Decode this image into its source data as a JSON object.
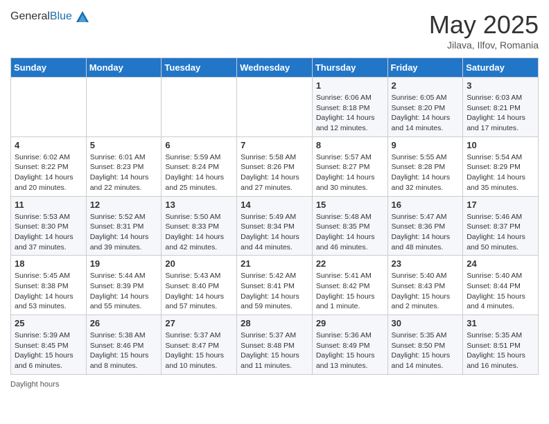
{
  "header": {
    "logo_general": "General",
    "logo_blue": "Blue",
    "month_title": "May 2025",
    "location": "Jilava, Ilfov, Romania"
  },
  "days_of_week": [
    "Sunday",
    "Monday",
    "Tuesday",
    "Wednesday",
    "Thursday",
    "Friday",
    "Saturday"
  ],
  "weeks": [
    [
      {
        "day": "",
        "info": ""
      },
      {
        "day": "",
        "info": ""
      },
      {
        "day": "",
        "info": ""
      },
      {
        "day": "",
        "info": ""
      },
      {
        "day": "1",
        "info": "Sunrise: 6:06 AM\nSunset: 8:18 PM\nDaylight: 14 hours\nand 12 minutes."
      },
      {
        "day": "2",
        "info": "Sunrise: 6:05 AM\nSunset: 8:20 PM\nDaylight: 14 hours\nand 14 minutes."
      },
      {
        "day": "3",
        "info": "Sunrise: 6:03 AM\nSunset: 8:21 PM\nDaylight: 14 hours\nand 17 minutes."
      }
    ],
    [
      {
        "day": "4",
        "info": "Sunrise: 6:02 AM\nSunset: 8:22 PM\nDaylight: 14 hours\nand 20 minutes."
      },
      {
        "day": "5",
        "info": "Sunrise: 6:01 AM\nSunset: 8:23 PM\nDaylight: 14 hours\nand 22 minutes."
      },
      {
        "day": "6",
        "info": "Sunrise: 5:59 AM\nSunset: 8:24 PM\nDaylight: 14 hours\nand 25 minutes."
      },
      {
        "day": "7",
        "info": "Sunrise: 5:58 AM\nSunset: 8:26 PM\nDaylight: 14 hours\nand 27 minutes."
      },
      {
        "day": "8",
        "info": "Sunrise: 5:57 AM\nSunset: 8:27 PM\nDaylight: 14 hours\nand 30 minutes."
      },
      {
        "day": "9",
        "info": "Sunrise: 5:55 AM\nSunset: 8:28 PM\nDaylight: 14 hours\nand 32 minutes."
      },
      {
        "day": "10",
        "info": "Sunrise: 5:54 AM\nSunset: 8:29 PM\nDaylight: 14 hours\nand 35 minutes."
      }
    ],
    [
      {
        "day": "11",
        "info": "Sunrise: 5:53 AM\nSunset: 8:30 PM\nDaylight: 14 hours\nand 37 minutes."
      },
      {
        "day": "12",
        "info": "Sunrise: 5:52 AM\nSunset: 8:31 PM\nDaylight: 14 hours\nand 39 minutes."
      },
      {
        "day": "13",
        "info": "Sunrise: 5:50 AM\nSunset: 8:33 PM\nDaylight: 14 hours\nand 42 minutes."
      },
      {
        "day": "14",
        "info": "Sunrise: 5:49 AM\nSunset: 8:34 PM\nDaylight: 14 hours\nand 44 minutes."
      },
      {
        "day": "15",
        "info": "Sunrise: 5:48 AM\nSunset: 8:35 PM\nDaylight: 14 hours\nand 46 minutes."
      },
      {
        "day": "16",
        "info": "Sunrise: 5:47 AM\nSunset: 8:36 PM\nDaylight: 14 hours\nand 48 minutes."
      },
      {
        "day": "17",
        "info": "Sunrise: 5:46 AM\nSunset: 8:37 PM\nDaylight: 14 hours\nand 50 minutes."
      }
    ],
    [
      {
        "day": "18",
        "info": "Sunrise: 5:45 AM\nSunset: 8:38 PM\nDaylight: 14 hours\nand 53 minutes."
      },
      {
        "day": "19",
        "info": "Sunrise: 5:44 AM\nSunset: 8:39 PM\nDaylight: 14 hours\nand 55 minutes."
      },
      {
        "day": "20",
        "info": "Sunrise: 5:43 AM\nSunset: 8:40 PM\nDaylight: 14 hours\nand 57 minutes."
      },
      {
        "day": "21",
        "info": "Sunrise: 5:42 AM\nSunset: 8:41 PM\nDaylight: 14 hours\nand 59 minutes."
      },
      {
        "day": "22",
        "info": "Sunrise: 5:41 AM\nSunset: 8:42 PM\nDaylight: 15 hours\nand 1 minute."
      },
      {
        "day": "23",
        "info": "Sunrise: 5:40 AM\nSunset: 8:43 PM\nDaylight: 15 hours\nand 2 minutes."
      },
      {
        "day": "24",
        "info": "Sunrise: 5:40 AM\nSunset: 8:44 PM\nDaylight: 15 hours\nand 4 minutes."
      }
    ],
    [
      {
        "day": "25",
        "info": "Sunrise: 5:39 AM\nSunset: 8:45 PM\nDaylight: 15 hours\nand 6 minutes."
      },
      {
        "day": "26",
        "info": "Sunrise: 5:38 AM\nSunset: 8:46 PM\nDaylight: 15 hours\nand 8 minutes."
      },
      {
        "day": "27",
        "info": "Sunrise: 5:37 AM\nSunset: 8:47 PM\nDaylight: 15 hours\nand 10 minutes."
      },
      {
        "day": "28",
        "info": "Sunrise: 5:37 AM\nSunset: 8:48 PM\nDaylight: 15 hours\nand 11 minutes."
      },
      {
        "day": "29",
        "info": "Sunrise: 5:36 AM\nSunset: 8:49 PM\nDaylight: 15 hours\nand 13 minutes."
      },
      {
        "day": "30",
        "info": "Sunrise: 5:35 AM\nSunset: 8:50 PM\nDaylight: 15 hours\nand 14 minutes."
      },
      {
        "day": "31",
        "info": "Sunrise: 5:35 AM\nSunset: 8:51 PM\nDaylight: 15 hours\nand 16 minutes."
      }
    ]
  ],
  "footer": {
    "daylight_label": "Daylight hours"
  }
}
